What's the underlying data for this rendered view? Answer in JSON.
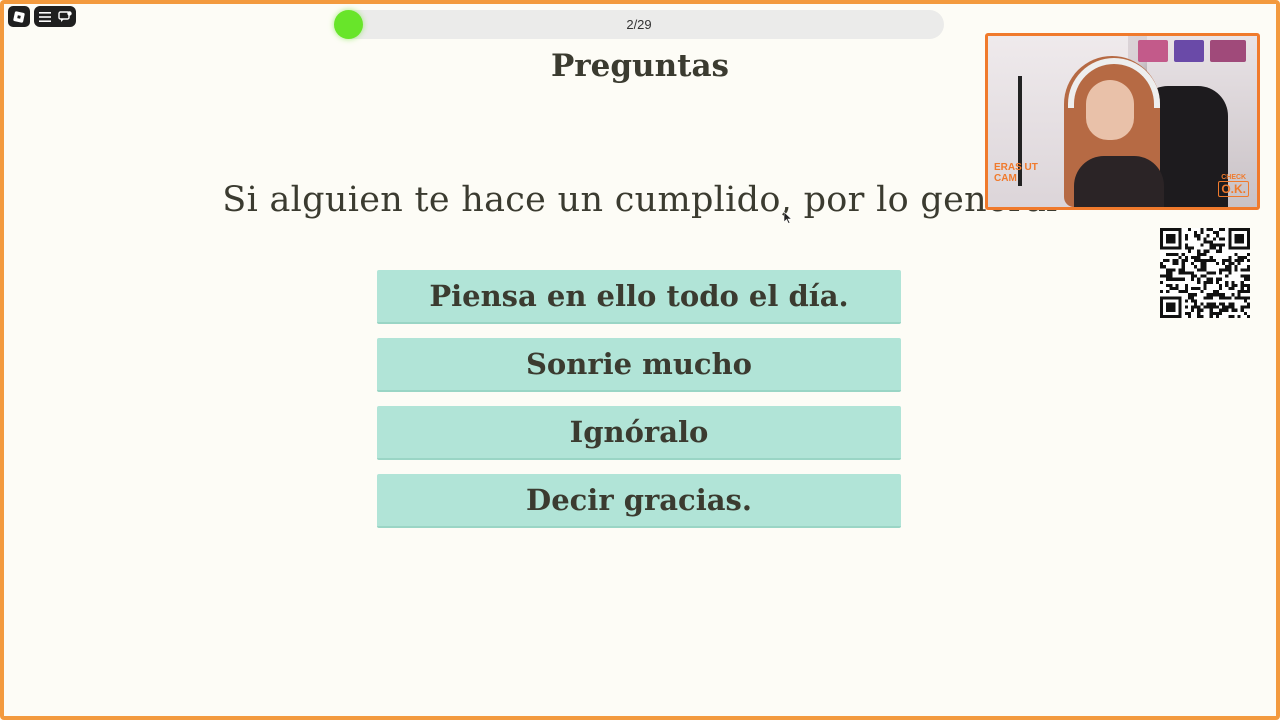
{
  "toolbar": {
    "app_icon": "roblox-logo-icon",
    "menu_icon": "hamburger-menu-icon",
    "chat_icon": "chat-bubble-icon"
  },
  "progress": {
    "label": "2/29",
    "current": 2,
    "total": 29,
    "fill_color": "#68e52a"
  },
  "page_title": "Preguntas",
  "question": "Si alguien te hace un cumplido, por lo general",
  "answers": [
    {
      "label": "Piensa en ello todo el día."
    },
    {
      "label": "Sonrie mucho"
    },
    {
      "label": "Ignóralo"
    },
    {
      "label": "Decir gracias."
    }
  ],
  "webcam": {
    "left_badge_line1": "ERAS UT",
    "left_badge_line2": "CAM",
    "right_badge_small": "CHECK",
    "right_badge_big": "O.K."
  },
  "colors": {
    "background": "#fdfcf6",
    "answer_bg": "#b1e4d7",
    "frame_border": "#f39a3e",
    "text": "#3b3b30"
  }
}
